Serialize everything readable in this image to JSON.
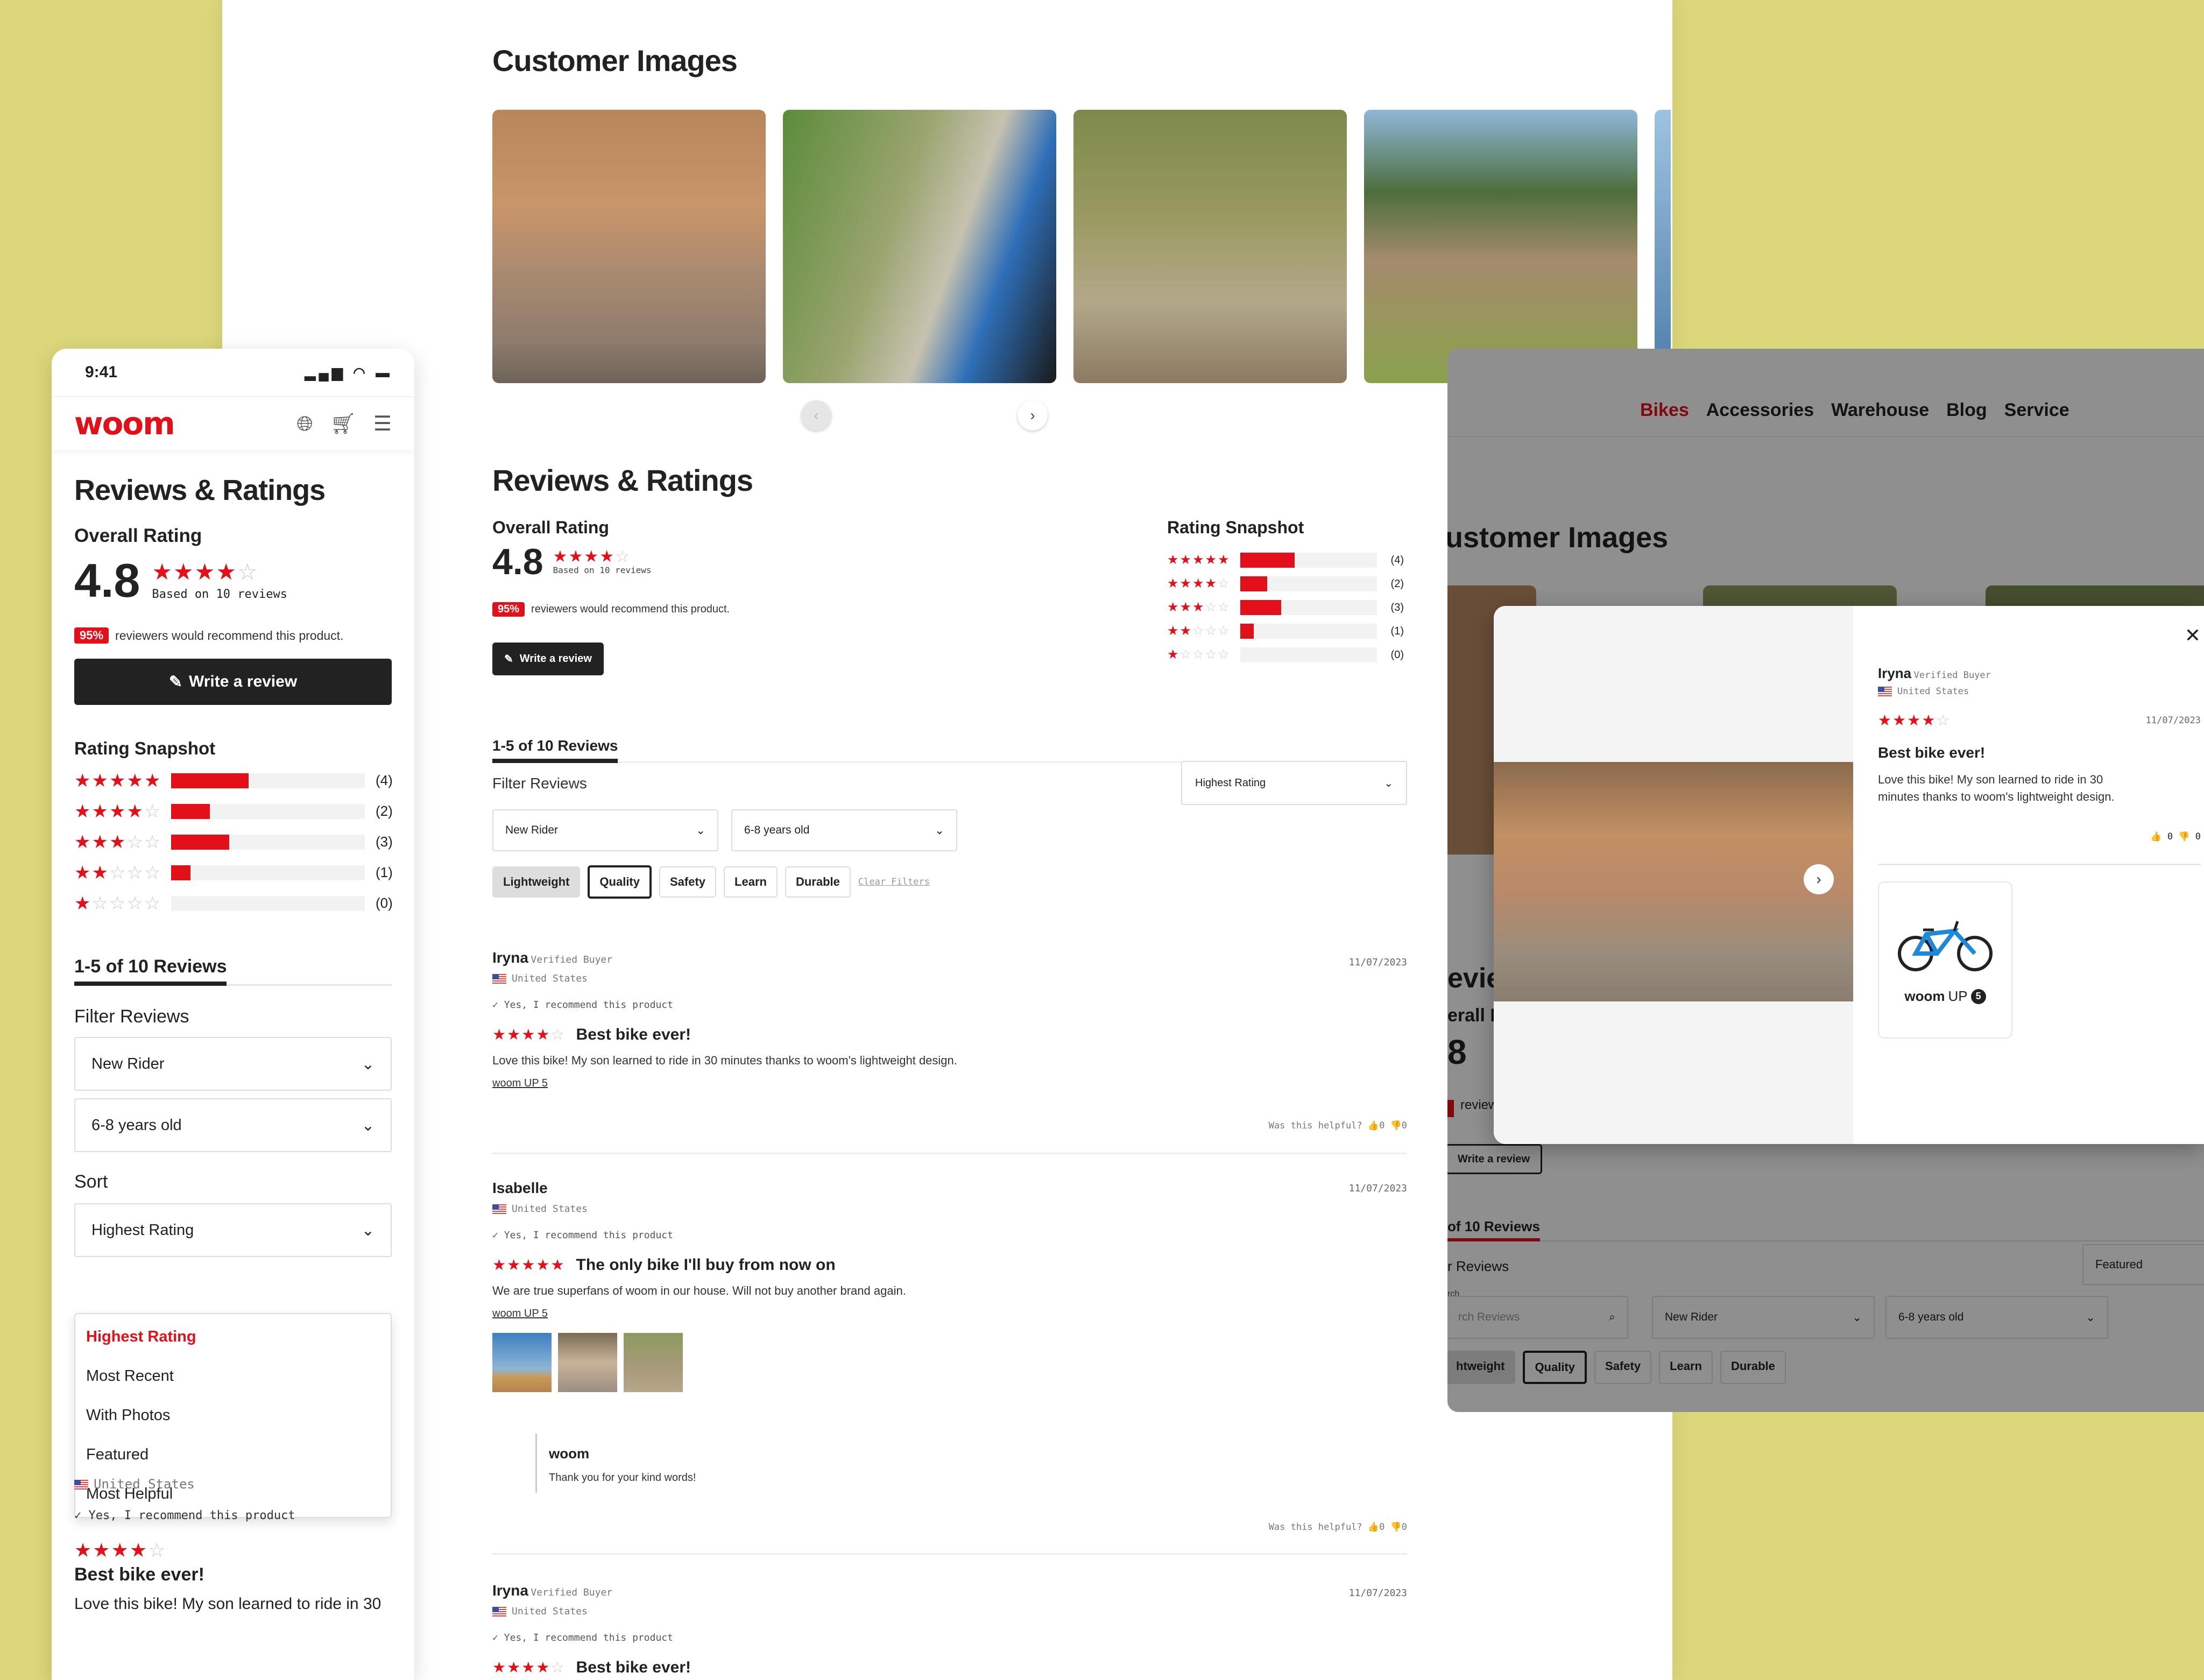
{
  "brand": {
    "logo": "woom",
    "accent": "#e3101a"
  },
  "customer_images": {
    "title": "Customer Images",
    "images": [
      "boy-riding-blue-bike-quarry",
      "hand-on-bike-display",
      "father-and-son-trail-ride",
      "kids-with-bikes-by-cabin"
    ],
    "prev_icon": "‹",
    "next_icon": "›"
  },
  "reviews_section": {
    "title": "Reviews & Ratings",
    "overall": {
      "label": "Overall Rating",
      "score": "4.8",
      "stars": 4,
      "based_on": "Based on 10 reviews",
      "recommend_pct": "95%",
      "recommend_text": "reviewers would recommend this product."
    },
    "write_review": "Write a review",
    "snapshot": {
      "title": "Rating Snapshot",
      "rows": [
        {
          "stars": 5,
          "count": 4,
          "label": "(4)"
        },
        {
          "stars": 4,
          "count": 2,
          "label": "(2)"
        },
        {
          "stars": 3,
          "count": 3,
          "label": "(3)"
        },
        {
          "stars": 2,
          "count": 1,
          "label": "(1)"
        },
        {
          "stars": 1,
          "count": 0,
          "label": "(0)"
        }
      ],
      "max": 10
    },
    "count_tab": "1-5 of 10 Reviews",
    "filter_label": "Filter Reviews",
    "sort_label": "Sort",
    "sort_selected": "Highest Rating",
    "filter_rider": "New Rider",
    "filter_age": "6-8 years old",
    "chips": [
      "Lightweight",
      "Quality",
      "Safety",
      "Learn",
      "Durable"
    ],
    "active_chip": "Lightweight",
    "focused_chip": "Quality",
    "clear_filters": "Clear Filters",
    "sort_options": [
      "Highest Rating",
      "Most Recent",
      "With Photos",
      "Featured",
      "Most Helpful"
    ],
    "helpful_label": "Was this helpful?",
    "reviews": [
      {
        "name": "Iryna",
        "badge": "Verified Buyer",
        "country": "United States",
        "date": "11/07/2023",
        "recommend": "Yes, I recommend this product",
        "stars": 4,
        "title": "Best bike ever!",
        "body": "Love this bike! My son learned to ride in 30 minutes thanks to woom's lightweight design.",
        "product": "woom UP 5",
        "up": "0",
        "down": "0"
      },
      {
        "name": "Isabelle",
        "badge": "",
        "country": "United States",
        "date": "11/07/2023",
        "recommend": "Yes, I recommend this product",
        "stars": 5,
        "title": "The only bike I'll buy from now on",
        "body": "We are true superfans of woom in our house. Will not buy another brand again.",
        "product": "woom UP 5",
        "photos": 3,
        "reply": {
          "author": "woom",
          "text": "Thank you for your kind words!"
        },
        "up": "0",
        "down": "0"
      },
      {
        "name": "Iryna",
        "badge": "Verified Buyer",
        "country": "United States",
        "date": "11/07/2023",
        "recommend": "Yes, I recommend this product",
        "stars": 4,
        "title": "Best bike ever!"
      }
    ]
  },
  "mobile": {
    "time": "9:41",
    "mobile_review_body": "Love this bike! My son learned to ride in 30"
  },
  "desktop_modal_view": {
    "nav": [
      "Bikes",
      "Accessories",
      "Warehouse",
      "Blog",
      "Service"
    ],
    "active_nav": "Bikes",
    "heading_fragment": "ustomer Images",
    "reviews_fragment": "evie",
    "overall_fragment": "erall R",
    "score_fragment": "8",
    "recommend_fragment": "review",
    "write_review": "Write a review",
    "count_fragment": "of 10 Reviews",
    "filter_fragment": "r Reviews",
    "sort_selected": "Featured",
    "search_label": "rch",
    "search_placeholder": "rch Reviews",
    "filter_rider": "New Rider",
    "filter_age": "6-8 years old",
    "chip_fragment": "htweight",
    "chips": [
      "Quality",
      "Safety",
      "Learn",
      "Durable"
    ],
    "modal": {
      "name": "Iryna",
      "badge": "Verified Buyer",
      "country": "United States",
      "stars": 4,
      "date": "11/07/2023",
      "title": "Best bike ever!",
      "body": "Love this bike! My son learned to ride in 30 minutes thanks to woom's lightweight design.",
      "up": "0",
      "down": "0",
      "product_brand": "woom",
      "product_model": "UP",
      "product_size": "5"
    }
  }
}
